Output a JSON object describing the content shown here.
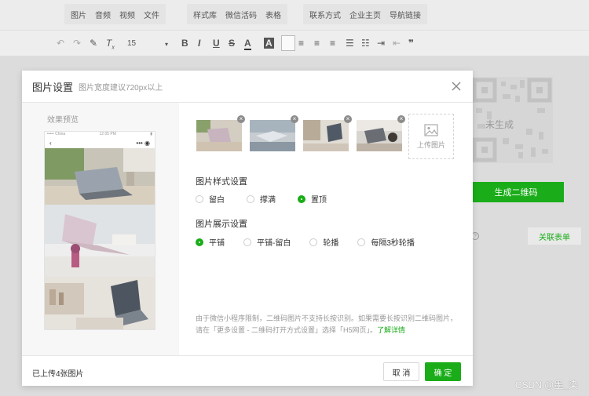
{
  "toolbar_top": {
    "group1": [
      "图片",
      "音频",
      "视频",
      "文件"
    ],
    "group2": [
      "样式库",
      "微信活码",
      "表格"
    ],
    "group3": [
      "联系方式",
      "企业主页",
      "导航链接"
    ]
  },
  "toolbar_fmt": {
    "font_size": "15",
    "bold": "B",
    "italic": "I",
    "underline": "U",
    "strike": "S",
    "font_color": "A",
    "bg_color": "A",
    "quote": "❞"
  },
  "background": {
    "qr_status": "未生成",
    "generate_button": "生成二维码",
    "relate_button": "关联表单",
    "watermark": "CSDN @墨_染"
  },
  "modal": {
    "title": "图片设置",
    "subtitle": "图片宽度建议720px以上",
    "preview_label": "效果预览",
    "phone_status_left": "••••• China",
    "phone_status_time": "12:05 PM",
    "upload_label": "上传图片",
    "style_section": {
      "title": "图片样式设置",
      "options": [
        "留白",
        "撑满",
        "置顶"
      ],
      "selected": "置顶"
    },
    "display_section": {
      "title": "图片展示设置",
      "options": [
        "平铺",
        "平铺-留白",
        "轮播",
        "每隔3秒轮播"
      ],
      "selected": "平铺"
    },
    "note_line1": "由于微信小程序限制，二维码图片不支持长按识别。如果需要长按识别二维码图片，",
    "note_line2": "请在「更多设置 - 二维码打开方式设置」选择「H5网页」。",
    "note_link": "了解详情",
    "uploaded_count": "已上传4张图片",
    "cancel_button": "取 消",
    "ok_button": "确 定"
  },
  "colors": {
    "accent": "#1aad19",
    "muted": "#999999"
  }
}
